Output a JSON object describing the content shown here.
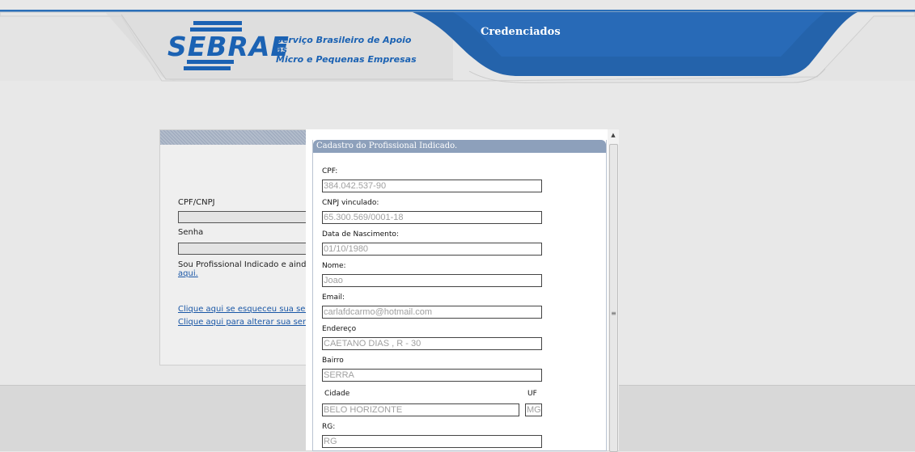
{
  "header": {
    "logo_text": "SEBRAE",
    "logo_subtitle_line1": "Serviço Brasileiro de Apoio às",
    "logo_subtitle_line2": "Micro e Pequenas Empresas",
    "tab_label": "Credenciados"
  },
  "login": {
    "cpf_label": "CPF/CNPJ",
    "cpf_value": "",
    "senha_label": "Senha",
    "senha_value": "",
    "indicado_text": "Sou Profissional Indicado e ainda",
    "aqui_link": "aqui.",
    "forgot_link": "Clique aqui se esqueceu sua sen",
    "change_link": "Clique aqui para alterar sua senha"
  },
  "modal": {
    "title": "Cadastro do Profissional Indicado.",
    "fields": {
      "cpf_label": "CPF:",
      "cpf_value": "384.042.537-90",
      "cnpj_label": "CNPJ vinculado:",
      "cnpj_value": "65.300.569/0001-18",
      "nascimento_label": "Data de Nascimento:",
      "nascimento_value": "01/10/1980",
      "nome_label": "Nome:",
      "nome_value": "Joao",
      "email_label": "Email:",
      "email_value": "carlafdcarmo@hotmail.com",
      "endereco_label": "Endereço",
      "endereco_value": "CAETANO DIAS , R - 30",
      "bairro_label": "Bairro",
      "bairro_value": "SERRA",
      "cidade_label": "Cidade",
      "cidade_value": "BELO HORIZONTE",
      "uf_label": "UF",
      "uf_value": "MG",
      "rg_label": "RG:",
      "rg_placeholder": "RG"
    }
  },
  "icons": {
    "scroll_up": "scroll-up-arrow-icon",
    "scroll_grip": "scroll-grip-icon"
  },
  "colors": {
    "brand_blue": "#1b62b3",
    "tab_blue": "#1f5fa8",
    "panel_title": "#8da0bb"
  }
}
